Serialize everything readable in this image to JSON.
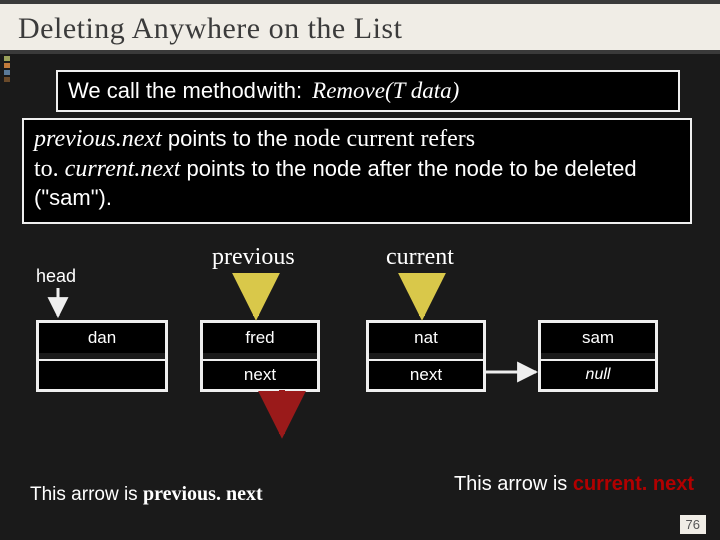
{
  "title": "Deleting  Anywhere  on the  List",
  "method_line": {
    "prefix": "We call the method",
    "with": "with:",
    "call": "Remove(T data)"
  },
  "explanation": {
    "p1a": "previous.next",
    "p1b": "  points  to the ",
    "p1c": "node  current  refers",
    "p2a": "to.   ",
    "p2b": "current.next",
    "p2c": "   points to the node after the node to be deleted (\"sam\")."
  },
  "labels": {
    "head": "head",
    "previous": "previous",
    "current": "current"
  },
  "nodes": [
    {
      "data": "dan",
      "next": ""
    },
    {
      "data": "fred",
      "next": "next"
    },
    {
      "data": "nat",
      "next": "next"
    },
    {
      "data": "sam",
      "next": "null"
    }
  ],
  "footers": {
    "left_prefix": "This arrow is ",
    "left_value": "previous. next",
    "right_prefix": "This arrow is  ",
    "right_value": "current. next"
  },
  "page_number": "76",
  "colors": {
    "title_bg": "#f0ede6",
    "slide_bg": "#1a1a1a",
    "accent_red": "#b20000"
  }
}
